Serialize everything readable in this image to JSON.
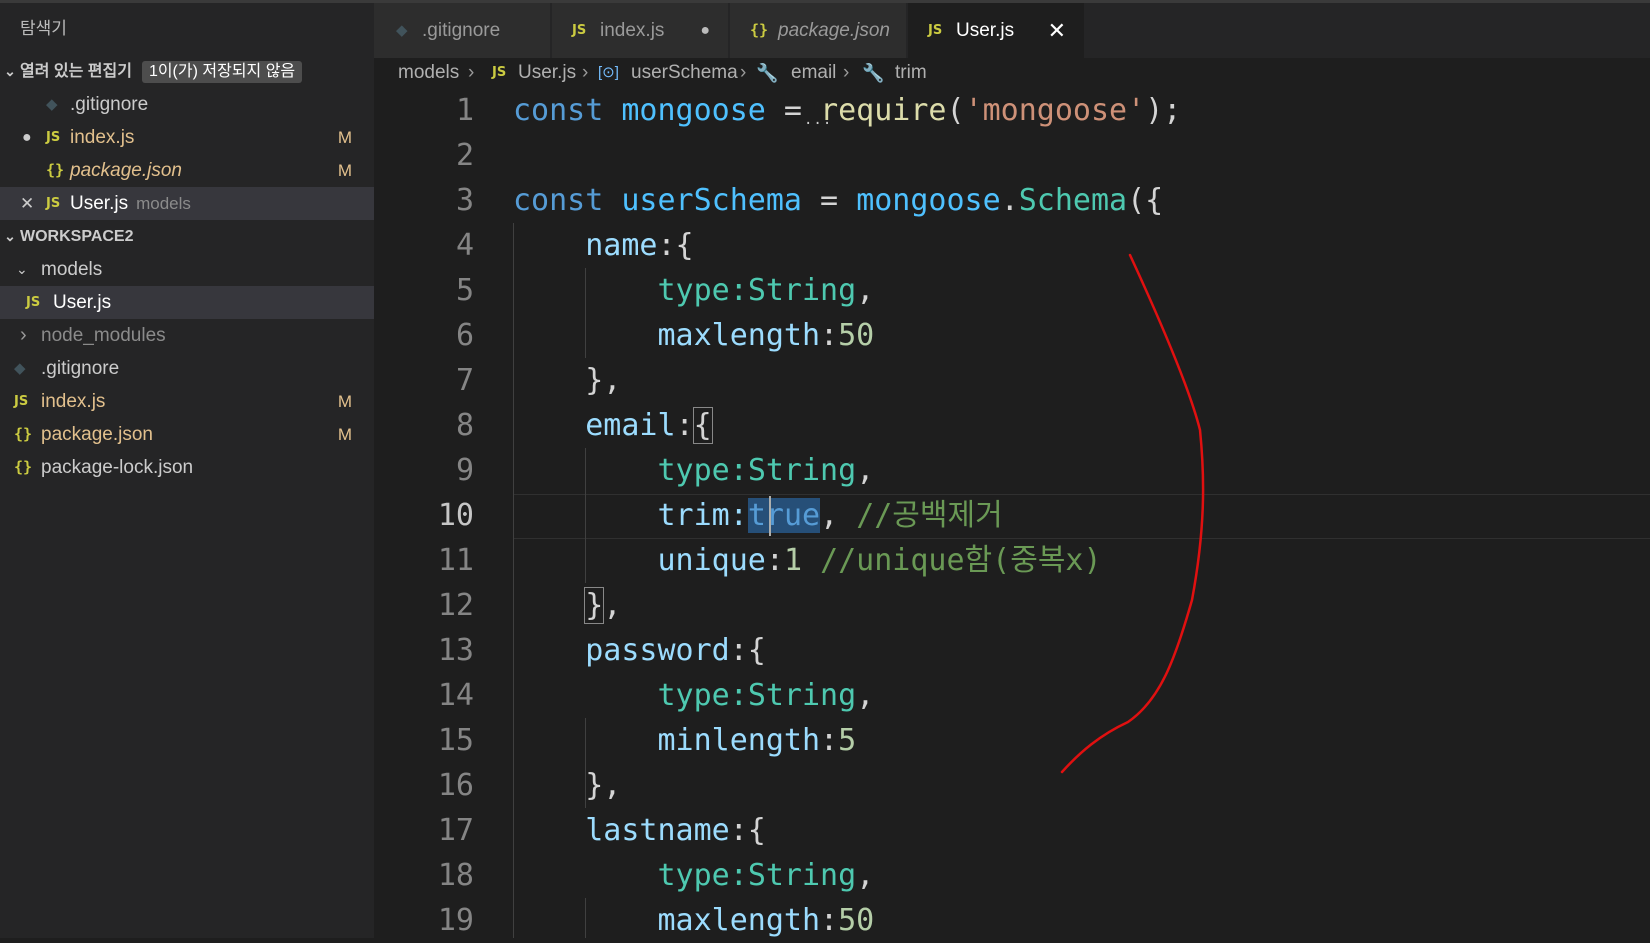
{
  "sidebar": {
    "title": "탐색기",
    "open_editors": {
      "label": "열려 있는 편집기",
      "badge": "1이(가) 저장되지 않음",
      "items": [
        {
          "name": ".gitignore",
          "icon": "git-icon",
          "badge": ""
        },
        {
          "name": "index.js",
          "icon": "js-icon",
          "badge": "M"
        },
        {
          "name": "package.json",
          "icon": "json-icon",
          "badge": "M"
        },
        {
          "name": "User.js",
          "icon": "js-icon",
          "desc": "models"
        }
      ]
    },
    "workspace": {
      "label": "WORKSPACE2",
      "items": [
        {
          "name": "models",
          "type": "folder-open"
        },
        {
          "name": "User.js",
          "icon": "js-icon"
        },
        {
          "name": "node_modules",
          "type": "folder-closed"
        },
        {
          "name": ".gitignore",
          "icon": "git-icon"
        },
        {
          "name": "index.js",
          "icon": "js-icon",
          "badge": "M"
        },
        {
          "name": "package.json",
          "icon": "json-icon",
          "badge": "M"
        },
        {
          "name": "package-lock.json",
          "icon": "json-icon"
        }
      ]
    }
  },
  "icons": {
    "js": "JS",
    "json": "{}",
    "git": "◆",
    "chev_down": "⌄",
    "chev_right": "›",
    "close": "✕",
    "dot": "●",
    "symbol": "[⊙]",
    "wrench": "🔧"
  },
  "tabs": [
    {
      "label": ".gitignore",
      "icon": "git-icon"
    },
    {
      "label": "index.js",
      "icon": "js-icon",
      "dirty": true
    },
    {
      "label": "package.json",
      "icon": "json-icon"
    },
    {
      "label": "User.js",
      "icon": "js-icon",
      "active": true
    }
  ],
  "breadcrumb": {
    "items": [
      "models",
      "User.js",
      "userSchema",
      "email",
      "trim"
    ]
  },
  "editor": {
    "line_numbers": [
      "1",
      "2",
      "3",
      "4",
      "5",
      "6",
      "7",
      "8",
      "9",
      "10",
      "11",
      "12",
      "13",
      "14",
      "15",
      "16",
      "17",
      "18",
      "19"
    ],
    "current_line": 10,
    "tokens": {
      "l1": [
        "const",
        " mongoose",
        " = ",
        "require",
        "(",
        "'mongoose'",
        ");"
      ],
      "l3": [
        "const",
        " userSchema",
        " = ",
        "mongoose",
        ".",
        "Schema",
        "({"
      ],
      "l4": [
        "    name",
        ":{"
      ],
      "l5": [
        "        type",
        ":",
        "String",
        ","
      ],
      "l6": [
        "        maxlength",
        ":",
        "50"
      ],
      "l7": [
        "    },"
      ],
      "l8": [
        "    email",
        ":",
        "{"
      ],
      "l9": [
        "        type",
        ":",
        "String",
        ","
      ],
      "l10": [
        "        trim",
        ":",
        "tr",
        "ue",
        ", ",
        "//공백제거"
      ],
      "l11": [
        "        unique",
        ":",
        "1",
        " ",
        "//unique함(중복x)"
      ],
      "l12": [
        "    ",
        "}",
        ","
      ],
      "l13": [
        "    password",
        ":{"
      ],
      "l14": [
        "        type",
        ":",
        "String",
        ","
      ],
      "l15": [
        "        minlength",
        ":",
        "5"
      ],
      "l16": [
        "    },"
      ],
      "l17": [
        "    lastname",
        ":{"
      ],
      "l18": [
        "        type",
        ":",
        "String",
        ","
      ],
      "l19": [
        "        maxlength",
        ":",
        "50"
      ]
    }
  },
  "annotation": {
    "color": "#e01010"
  }
}
